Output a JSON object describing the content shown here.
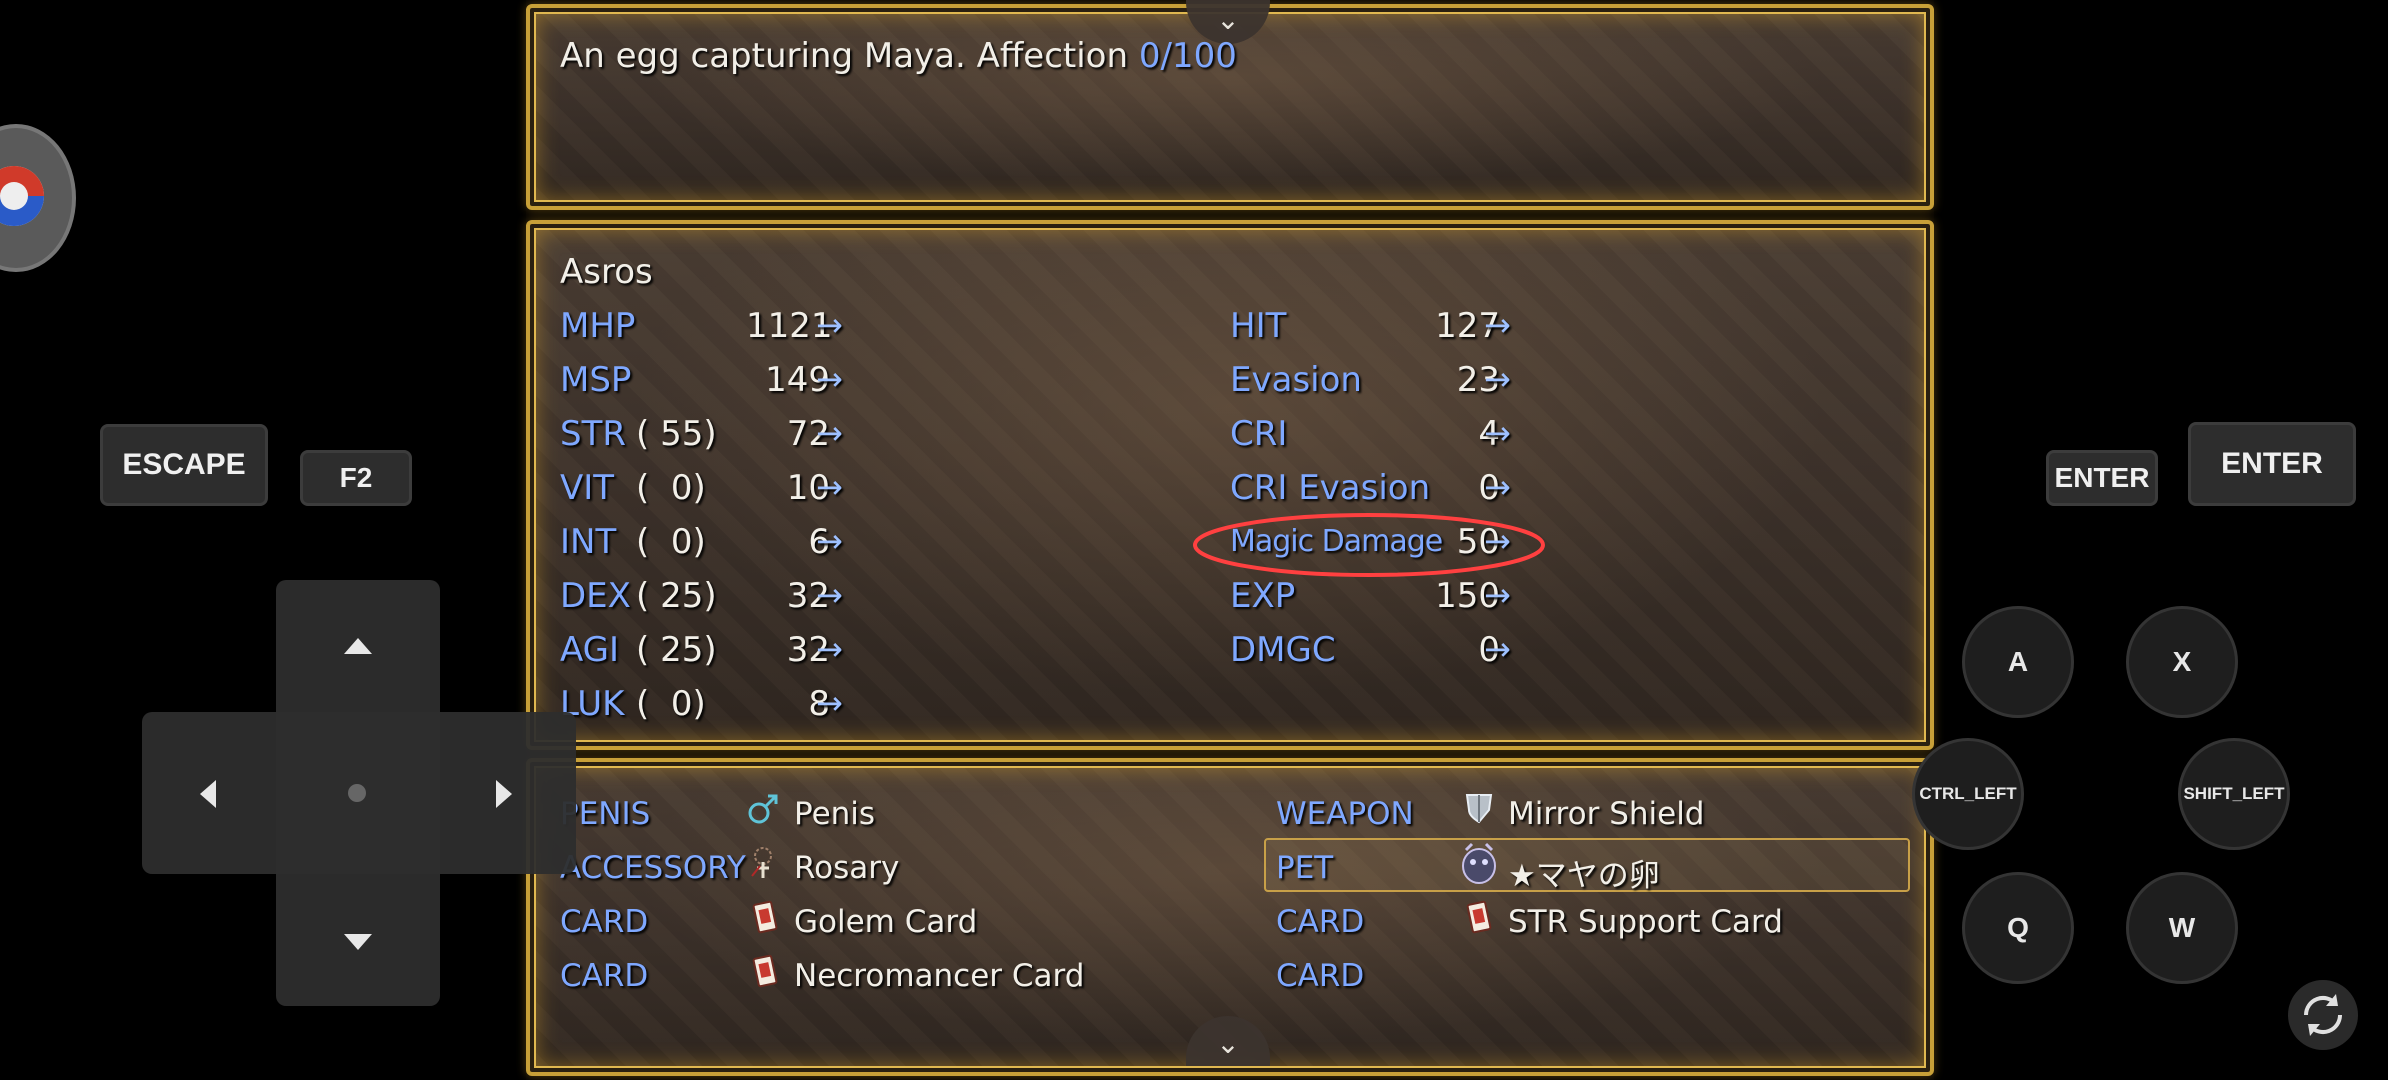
{
  "description": {
    "text": "An egg capturing Maya. Affection ",
    "affection": "0/100"
  },
  "character": {
    "name": "Asros",
    "left_stats": [
      {
        "label": "MHP",
        "base": "",
        "value": "1121"
      },
      {
        "label": "MSP",
        "base": "",
        "value": "149"
      },
      {
        "label": "STR",
        "base": "( 55)",
        "value": "72"
      },
      {
        "label": "VIT",
        "base": "(  0)",
        "value": "10"
      },
      {
        "label": "INT",
        "base": "(  0)",
        "value": "6"
      },
      {
        "label": "DEX",
        "base": "( 25)",
        "value": "32"
      },
      {
        "label": "AGI",
        "base": "( 25)",
        "value": "32"
      },
      {
        "label": "LUK",
        "base": "(  0)",
        "value": "8"
      }
    ],
    "right_stats": [
      {
        "label": "HIT",
        "value": "127"
      },
      {
        "label": "Evasion",
        "value": "23"
      },
      {
        "label": "CRI",
        "value": "4"
      },
      {
        "label": "CRI Evasion",
        "value": "0"
      },
      {
        "label": "Magic Damage",
        "value": "50"
      },
      {
        "label": "EXP",
        "value": "150"
      },
      {
        "label": "DMGC",
        "value": "0"
      }
    ],
    "arrow": "→",
    "highlight_color": "#ff3b3b"
  },
  "equipment": {
    "left": [
      {
        "slot": "PENIS",
        "item": "Penis",
        "icon": "male-symbol-icon"
      },
      {
        "slot": "ACCESSORY",
        "item": "Rosary",
        "icon": "rosary-icon"
      },
      {
        "slot": "CARD",
        "item": "Golem Card",
        "icon": "card-icon"
      },
      {
        "slot": "CARD",
        "item": "Necromancer Card",
        "icon": "card-icon"
      }
    ],
    "right": [
      {
        "slot": "WEAPON",
        "item": "Mirror Shield",
        "icon": "shield-icon"
      },
      {
        "slot": "PET",
        "item": "★マヤの卵",
        "icon": "pet-egg-icon"
      },
      {
        "slot": "CARD",
        "item": "STR Support Card",
        "icon": "card-icon"
      },
      {
        "slot": "CARD",
        "item": "",
        "icon": ""
      }
    ]
  },
  "controls": {
    "escape": "ESCAPE",
    "f2": "F2",
    "enter_small": "ENTER",
    "enter_large": "ENTER",
    "a": "A",
    "x": "X",
    "ctrl_left": "CTRL_LEFT",
    "shift_left": "SHIFT_LEFT",
    "q": "Q",
    "w": "W"
  }
}
